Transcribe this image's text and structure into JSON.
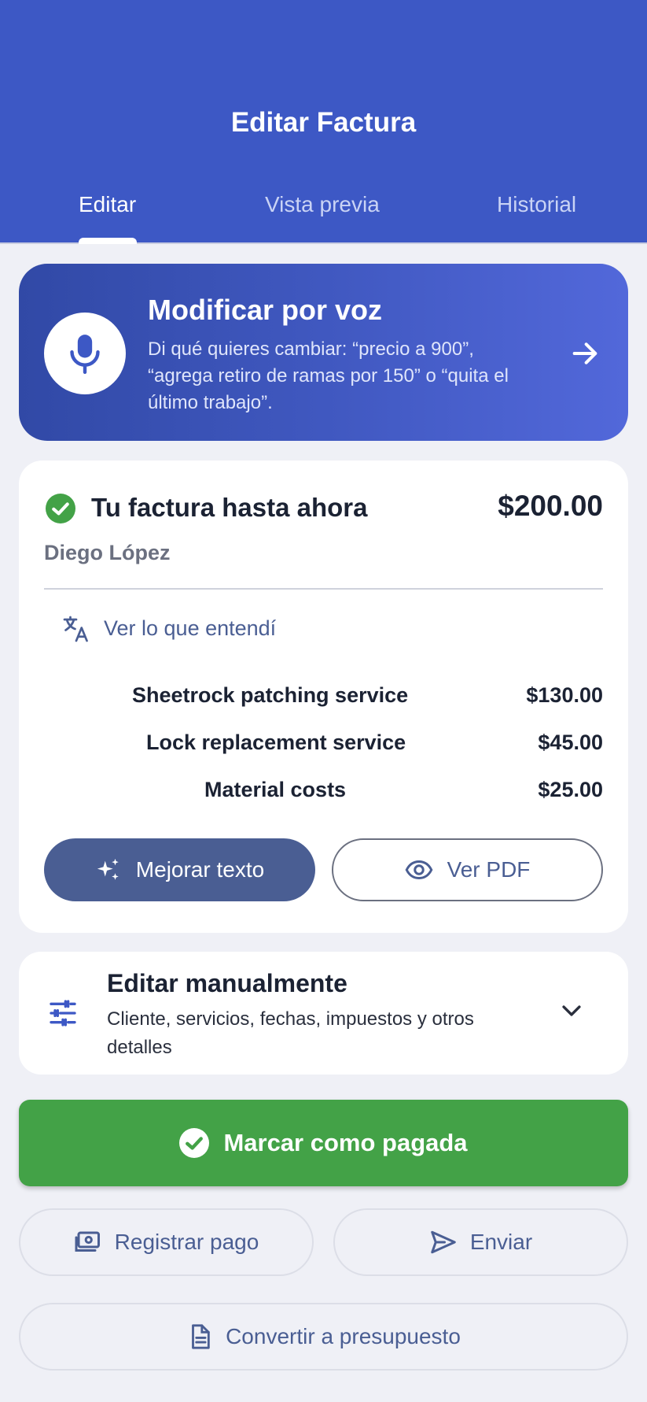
{
  "header": {
    "title": "Editar Factura",
    "tabs": [
      {
        "label": "Editar",
        "active": true
      },
      {
        "label": "Vista previa",
        "active": false
      },
      {
        "label": "Historial",
        "active": false
      }
    ],
    "color": "#3d58c5"
  },
  "voice": {
    "title": "Modificar por voz",
    "description": "Di qué quieres cambiar: “precio a 900”, “agrega retiro de ramas por 150” o “quita el último trabajo”.",
    "icon": "microphone-icon"
  },
  "invoice": {
    "title": "Tu factura hasta ahora",
    "total": "$200.00",
    "client": "Diego López",
    "understood_label": "Ver lo que entendí",
    "items": [
      {
        "description": "Sheetrock patching service",
        "amount": "$130.00"
      },
      {
        "description": "Lock replacement service",
        "amount": "$45.00"
      },
      {
        "description": "Material costs",
        "amount": "$25.00"
      }
    ],
    "improve_label": "Mejorar texto",
    "pdf_label": "Ver PDF"
  },
  "manual": {
    "title": "Editar manualmente",
    "description": "Cliente, servicios, fechas, impuestos y otros detalles"
  },
  "actions": {
    "mark_paid": "Marcar como pagada",
    "register_payment": "Registrar pago",
    "send": "Enviar",
    "convert": "Convertir a presupuesto"
  },
  "colors": {
    "primary": "#3d58c5",
    "accent": "#4a5e93",
    "success": "#43a247"
  }
}
